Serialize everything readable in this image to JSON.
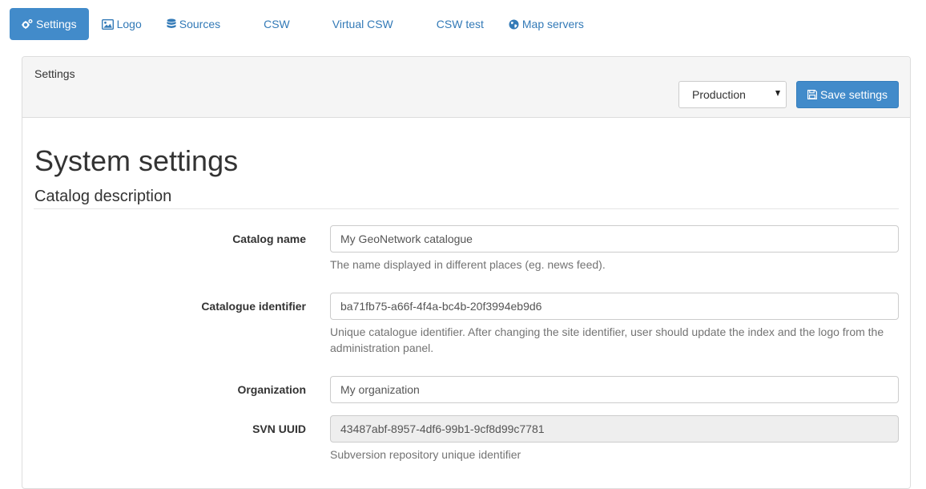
{
  "nav": {
    "tabs": [
      {
        "label": "Settings",
        "icon": "cogs-icon",
        "active": true
      },
      {
        "label": "Logo",
        "icon": "image-icon",
        "active": false
      },
      {
        "label": "Sources",
        "icon": "database-icon",
        "active": false
      },
      {
        "label": "CSW",
        "icon": "",
        "active": false
      },
      {
        "label": "Virtual CSW",
        "icon": "",
        "active": false
      },
      {
        "label": "CSW test",
        "icon": "",
        "active": false
      },
      {
        "label": "Map servers",
        "icon": "globe-icon",
        "active": false
      }
    ]
  },
  "panel": {
    "title": "Settings",
    "mode_select": {
      "value": "Production"
    },
    "save_label": "Save settings"
  },
  "page": {
    "title": "System settings",
    "section_title": "Catalog description"
  },
  "fields": [
    {
      "label": "Catalog name",
      "value": "My GeoNetwork catalogue",
      "help": "The name displayed in different places (eg. news feed).",
      "disabled": false
    },
    {
      "label": "Catalogue identifier",
      "value": "ba71fb75-a66f-4f4a-bc4b-20f3994eb9d6",
      "help": "Unique catalogue identifier. After changing the site identifier, user should update the index and the logo from the administration panel.",
      "disabled": false
    },
    {
      "label": "Organization",
      "value": "My organization",
      "help": "",
      "disabled": false
    },
    {
      "label": "SVN UUID",
      "value": "43487abf-8957-4df6-99b1-9cf8d99c7781",
      "help": "Subversion repository unique identifier",
      "disabled": true
    }
  ],
  "colors": {
    "primary": "#428bca",
    "link": "#337ab7",
    "panel_heading_bg": "#f5f5f5",
    "disabled_input_bg": "#eeeeee",
    "help_text": "#737373"
  }
}
